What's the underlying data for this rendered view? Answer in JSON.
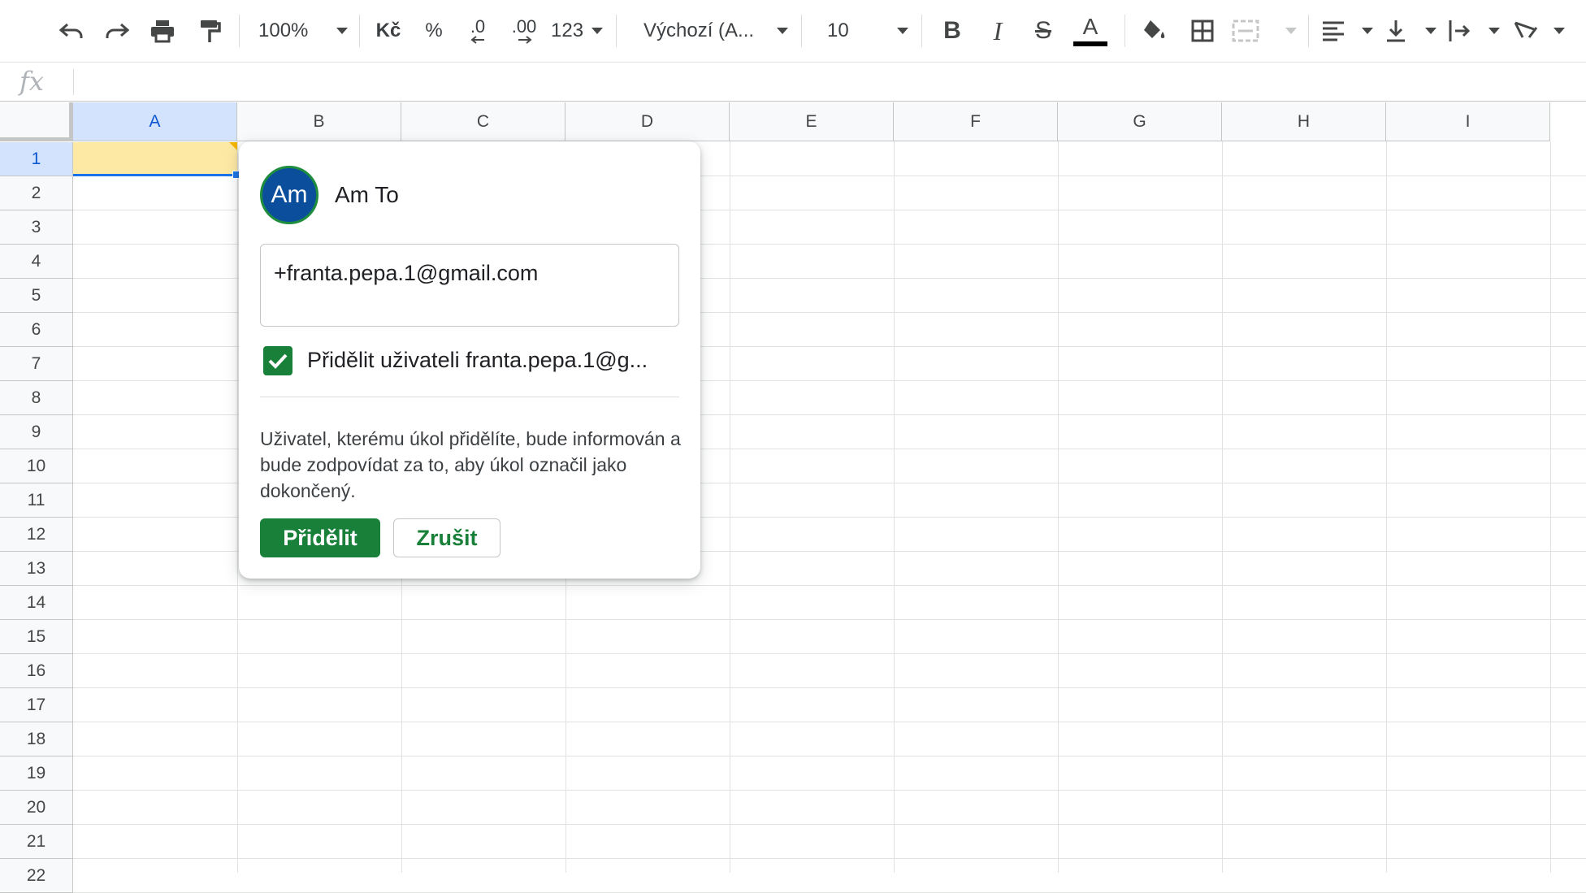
{
  "toolbar": {
    "zoom": "100%",
    "currency": "Kč",
    "percent": "%",
    "decimal_decrease": ".0",
    "decimal_increase": ".00",
    "number_format": "123",
    "font": "Výchozí (A...",
    "font_size": "10",
    "icons": [
      "undo-icon",
      "redo-icon",
      "print-icon",
      "paint-format-icon",
      "bold-icon",
      "italic-icon",
      "strikethrough-icon",
      "text-color-icon",
      "fill-color-icon",
      "borders-icon",
      "merge-cells-icon",
      "horizontal-align-icon",
      "vertical-align-icon",
      "text-wrapping-icon",
      "text-rotation-icon"
    ]
  },
  "formula_bar": {
    "label": "fx",
    "value": ""
  },
  "columns": [
    "A",
    "B",
    "C",
    "D",
    "E",
    "F",
    "G",
    "H",
    "I"
  ],
  "rows": [
    "1",
    "2",
    "3",
    "4",
    "5",
    "6",
    "7",
    "8",
    "9",
    "10",
    "11",
    "12",
    "13",
    "14",
    "15",
    "16",
    "17",
    "18",
    "19",
    "20",
    "21",
    "22"
  ],
  "selected_cell": "A1",
  "popup": {
    "avatar_initials": "Am",
    "name": "Am To",
    "mention": "+franta.pepa.1@gmail.com",
    "assign_checked": true,
    "assign_label": "Přidělit uživateli franta.pepa.1@g...",
    "info": "Uživatel, kterému úkol přidělíte, bude informován a bude zodpovídat za to, aby úkol označil jako dokončený.",
    "assign_button": "Přidělit",
    "cancel_button": "Zrušit"
  },
  "colors": {
    "accent_green": "#188038",
    "selection_blue": "#1a73e8",
    "selected_cell_fill": "#fde9a4",
    "avatar_bg": "#0b4f9c"
  }
}
